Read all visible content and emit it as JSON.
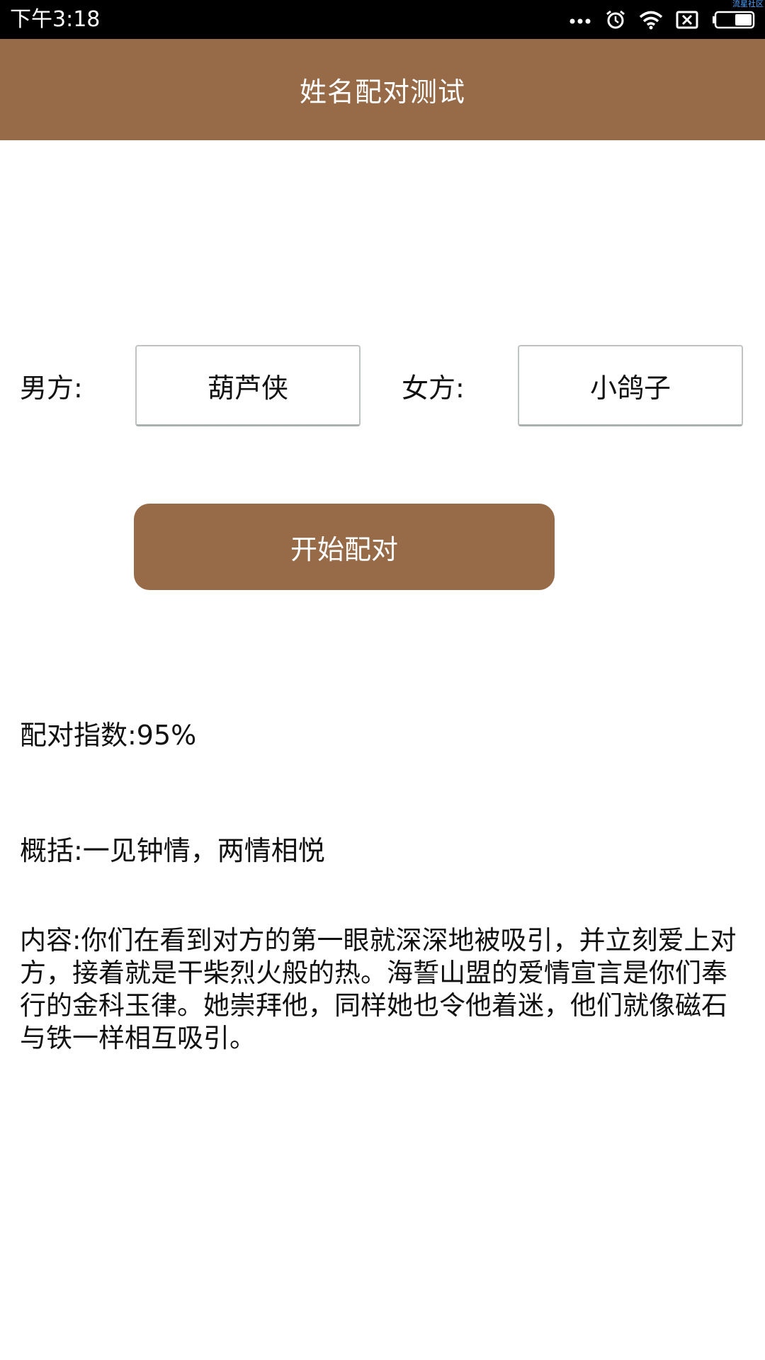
{
  "status_bar": {
    "time": "下午3:18",
    "icons": [
      "more-dots-icon",
      "alarm-icon",
      "wifi-icon",
      "sim-blocked-icon",
      "battery-icon"
    ],
    "watermark": "流星社区"
  },
  "app_bar": {
    "title": "姓名配对测试",
    "color": "#976b48"
  },
  "form": {
    "male_label": "男方:",
    "male_value": "葫芦侠",
    "female_label": "女方:",
    "female_value": "小鸽子"
  },
  "button": {
    "label": "开始配对"
  },
  "result": {
    "score": "配对指数:95%",
    "summary": "概括:一见钟情，两情相悦",
    "content": "内容:你们在看到对方的第一眼就深深地被吸引，并立刻爱上对方，接着就是干柴烈火般的热。海誓山盟的爱情宣言是你们奉行的金科玉律。她崇拜他，同样她也令他着迷，他们就像磁石与铁一样相互吸引。"
  }
}
